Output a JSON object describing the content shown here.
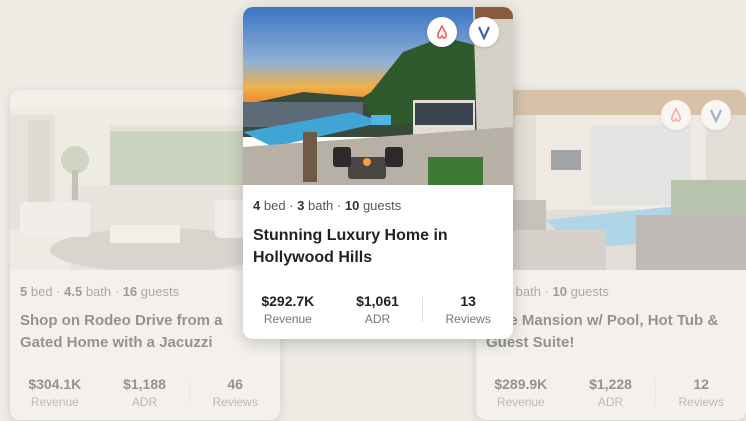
{
  "colors": {
    "airbnb": "#ff5a5f",
    "vrbo": "#3d67b1"
  },
  "listings": [
    {
      "beds": "5",
      "baths": "4.5",
      "guests": "16",
      "bed_label": "bed",
      "bath_label": "bath",
      "guest_label": "guests",
      "title": "Shop on Rodeo Drive from a Gated Home with a Jacuzzi",
      "revenue": "$304.1K",
      "revenue_label": "Revenue",
      "adr": "$1,188",
      "adr_label": "ADR",
      "reviews": "46",
      "reviews_label": "Reviews"
    },
    {
      "beds": "4",
      "baths": "3",
      "guests": "10",
      "bed_label": "bed",
      "bath_label": "bath",
      "guest_label": "guests",
      "title": "Stunning Luxury Home in Hollywood Hills",
      "revenue": "$292.7K",
      "revenue_label": "Revenue",
      "adr": "$1,061",
      "adr_label": "ADR",
      "reviews": "13",
      "reviews_label": "Reviews"
    },
    {
      "beds_visible": "d",
      "baths": "5",
      "guests": "10",
      "bath_label": "bath",
      "guest_label": "guests",
      "title": "rose Mansion w/ Pool, Hot Tub & Guest Suite!",
      "revenue": "$289.9K",
      "revenue_label": "Revenue",
      "adr": "$1,228",
      "adr_label": "ADR",
      "reviews": "12",
      "reviews_label": "Reviews"
    }
  ]
}
